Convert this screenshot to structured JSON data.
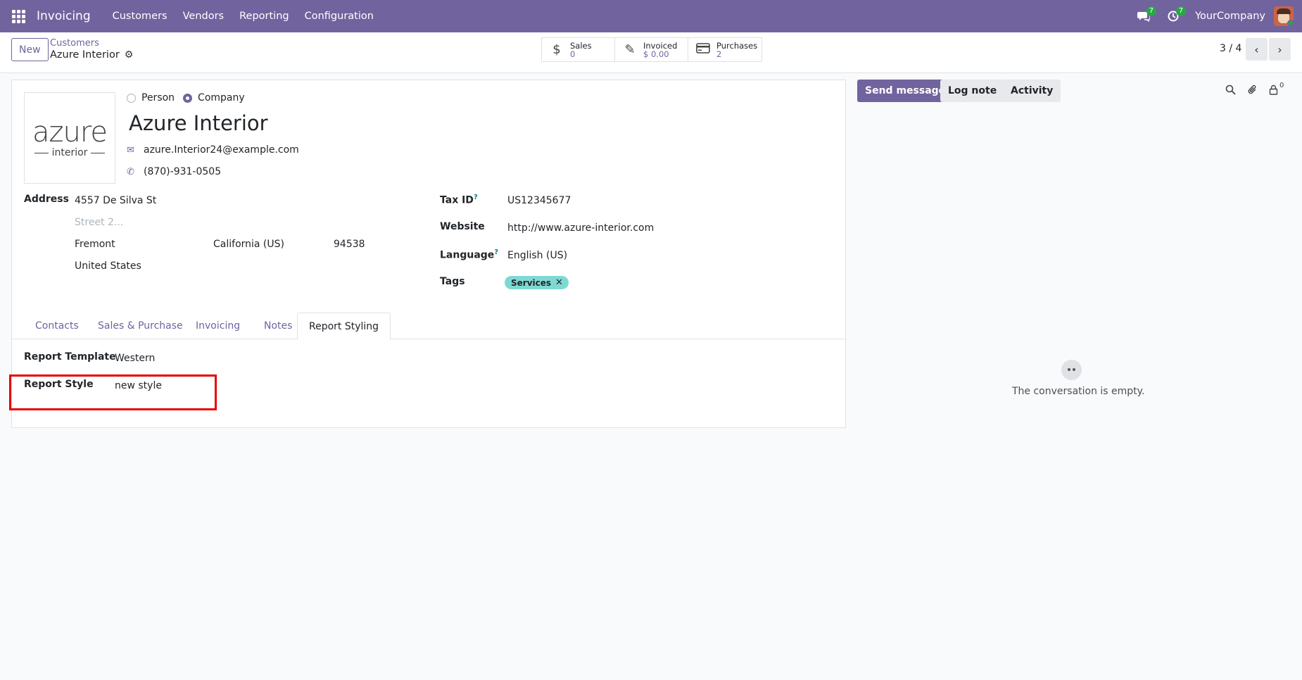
{
  "navbar": {
    "app_name": "Invoicing",
    "menu": [
      "Customers",
      "Vendors",
      "Reporting",
      "Configuration"
    ],
    "messages_count": "7",
    "activities_count": "7",
    "company": "YourCompany"
  },
  "control": {
    "new_label": "New",
    "breadcrumb": "Customers",
    "record_name": "Azure Interior",
    "stats": [
      {
        "label": "Sales",
        "value": "0",
        "icon": "dollar-icon"
      },
      {
        "label": "Invoiced",
        "value": "$ 0.00",
        "icon": "edit-icon"
      },
      {
        "label": "Purchases",
        "value": "2",
        "icon": "credit-card-icon"
      }
    ],
    "pager": "3 / 4"
  },
  "form": {
    "logo_main": "azure",
    "logo_sub": "interior",
    "type_options": [
      "Person",
      "Company"
    ],
    "type_selected": "Company",
    "name": "Azure Interior",
    "email": "azure.Interior24@example.com",
    "phone": "(870)-931-0505",
    "address_label": "Address",
    "street": "4557 De Silva St",
    "street2_placeholder": "Street 2...",
    "city": "Fremont",
    "state": "California (US)",
    "zip": "94538",
    "country": "United States",
    "tax_id_label": "Tax ID",
    "tax_id": "US12345677",
    "website_label": "Website",
    "website": "http://www.azure-interior.com",
    "language_label": "Language",
    "language": "English (US)",
    "tags_label": "Tags",
    "tags": [
      "Services"
    ],
    "help_marker": "?"
  },
  "tabs": [
    "Contacts",
    "Sales & Purchase",
    "Invoicing",
    "Notes",
    "Report Styling"
  ],
  "active_tab": "Report Styling",
  "report_styling": {
    "template_label": "Report Template",
    "template_value": "Western",
    "style_label": "Report Style",
    "style_value": "new style"
  },
  "chatter": {
    "send_message": "Send message",
    "log_note": "Log note",
    "activity": "Activity",
    "followers_count": "0",
    "empty_text": "The conversation is empty."
  },
  "colors": {
    "brand": "#71639e",
    "highlight": "#e60000",
    "tag": "#7fd9d3"
  }
}
